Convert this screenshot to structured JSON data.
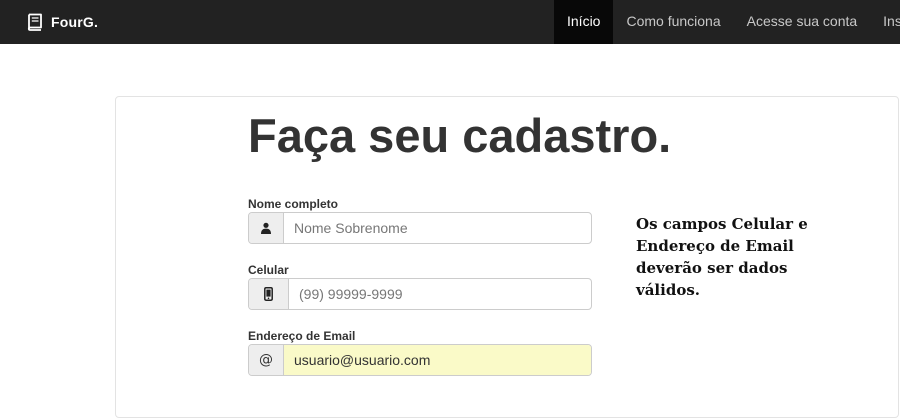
{
  "navbar": {
    "brand": "FourG.",
    "brand_icon": "book-icon",
    "links": [
      {
        "label": "Início",
        "active": true
      },
      {
        "label": "Como funciona",
        "active": false
      },
      {
        "label": "Acesse sua conta",
        "active": false
      },
      {
        "label": "Inscreva-se",
        "active": false
      }
    ]
  },
  "page": {
    "title": "Faça seu cadastro."
  },
  "form": {
    "name": {
      "label": "Nome completo",
      "icon": "user-icon",
      "placeholder": "Nome Sobrenome",
      "value": ""
    },
    "phone": {
      "label": "Celular",
      "icon": "mobile-phone-icon",
      "placeholder": "(99) 99999-9999",
      "value": ""
    },
    "email": {
      "label": "Endereço de Email",
      "icon_text": "@",
      "placeholder": "",
      "value": "usuario@usuario.com"
    }
  },
  "note": "Os campos Celular e Endereço de Email deverão ser dados válidos.",
  "colors": {
    "navbar_bg": "#222222",
    "active_link_bg": "#080808",
    "autofill_bg": "#fafac8",
    "addon_bg": "#eeeeee"
  }
}
